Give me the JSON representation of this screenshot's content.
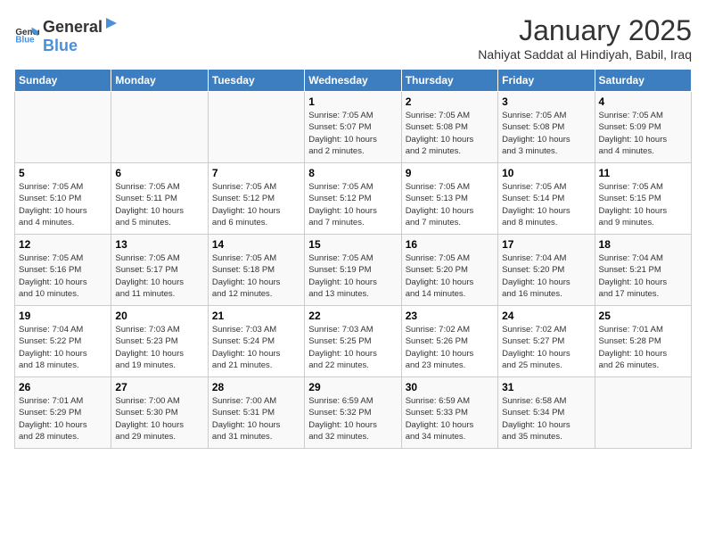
{
  "header": {
    "logo_general": "General",
    "logo_blue": "Blue",
    "title": "January 2025",
    "subtitle": "Nahiyat Saddat al Hindiyah, Babil, Iraq"
  },
  "days_of_week": [
    "Sunday",
    "Monday",
    "Tuesday",
    "Wednesday",
    "Thursday",
    "Friday",
    "Saturday"
  ],
  "weeks": [
    [
      {
        "day": "",
        "info": ""
      },
      {
        "day": "",
        "info": ""
      },
      {
        "day": "",
        "info": ""
      },
      {
        "day": "1",
        "info": "Sunrise: 7:05 AM\nSunset: 5:07 PM\nDaylight: 10 hours\nand 2 minutes."
      },
      {
        "day": "2",
        "info": "Sunrise: 7:05 AM\nSunset: 5:08 PM\nDaylight: 10 hours\nand 2 minutes."
      },
      {
        "day": "3",
        "info": "Sunrise: 7:05 AM\nSunset: 5:08 PM\nDaylight: 10 hours\nand 3 minutes."
      },
      {
        "day": "4",
        "info": "Sunrise: 7:05 AM\nSunset: 5:09 PM\nDaylight: 10 hours\nand 4 minutes."
      }
    ],
    [
      {
        "day": "5",
        "info": "Sunrise: 7:05 AM\nSunset: 5:10 PM\nDaylight: 10 hours\nand 4 minutes."
      },
      {
        "day": "6",
        "info": "Sunrise: 7:05 AM\nSunset: 5:11 PM\nDaylight: 10 hours\nand 5 minutes."
      },
      {
        "day": "7",
        "info": "Sunrise: 7:05 AM\nSunset: 5:12 PM\nDaylight: 10 hours\nand 6 minutes."
      },
      {
        "day": "8",
        "info": "Sunrise: 7:05 AM\nSunset: 5:12 PM\nDaylight: 10 hours\nand 7 minutes."
      },
      {
        "day": "9",
        "info": "Sunrise: 7:05 AM\nSunset: 5:13 PM\nDaylight: 10 hours\nand 7 minutes."
      },
      {
        "day": "10",
        "info": "Sunrise: 7:05 AM\nSunset: 5:14 PM\nDaylight: 10 hours\nand 8 minutes."
      },
      {
        "day": "11",
        "info": "Sunrise: 7:05 AM\nSunset: 5:15 PM\nDaylight: 10 hours\nand 9 minutes."
      }
    ],
    [
      {
        "day": "12",
        "info": "Sunrise: 7:05 AM\nSunset: 5:16 PM\nDaylight: 10 hours\nand 10 minutes."
      },
      {
        "day": "13",
        "info": "Sunrise: 7:05 AM\nSunset: 5:17 PM\nDaylight: 10 hours\nand 11 minutes."
      },
      {
        "day": "14",
        "info": "Sunrise: 7:05 AM\nSunset: 5:18 PM\nDaylight: 10 hours\nand 12 minutes."
      },
      {
        "day": "15",
        "info": "Sunrise: 7:05 AM\nSunset: 5:19 PM\nDaylight: 10 hours\nand 13 minutes."
      },
      {
        "day": "16",
        "info": "Sunrise: 7:05 AM\nSunset: 5:20 PM\nDaylight: 10 hours\nand 14 minutes."
      },
      {
        "day": "17",
        "info": "Sunrise: 7:04 AM\nSunset: 5:20 PM\nDaylight: 10 hours\nand 16 minutes."
      },
      {
        "day": "18",
        "info": "Sunrise: 7:04 AM\nSunset: 5:21 PM\nDaylight: 10 hours\nand 17 minutes."
      }
    ],
    [
      {
        "day": "19",
        "info": "Sunrise: 7:04 AM\nSunset: 5:22 PM\nDaylight: 10 hours\nand 18 minutes."
      },
      {
        "day": "20",
        "info": "Sunrise: 7:03 AM\nSunset: 5:23 PM\nDaylight: 10 hours\nand 19 minutes."
      },
      {
        "day": "21",
        "info": "Sunrise: 7:03 AM\nSunset: 5:24 PM\nDaylight: 10 hours\nand 21 minutes."
      },
      {
        "day": "22",
        "info": "Sunrise: 7:03 AM\nSunset: 5:25 PM\nDaylight: 10 hours\nand 22 minutes."
      },
      {
        "day": "23",
        "info": "Sunrise: 7:02 AM\nSunset: 5:26 PM\nDaylight: 10 hours\nand 23 minutes."
      },
      {
        "day": "24",
        "info": "Sunrise: 7:02 AM\nSunset: 5:27 PM\nDaylight: 10 hours\nand 25 minutes."
      },
      {
        "day": "25",
        "info": "Sunrise: 7:01 AM\nSunset: 5:28 PM\nDaylight: 10 hours\nand 26 minutes."
      }
    ],
    [
      {
        "day": "26",
        "info": "Sunrise: 7:01 AM\nSunset: 5:29 PM\nDaylight: 10 hours\nand 28 minutes."
      },
      {
        "day": "27",
        "info": "Sunrise: 7:00 AM\nSunset: 5:30 PM\nDaylight: 10 hours\nand 29 minutes."
      },
      {
        "day": "28",
        "info": "Sunrise: 7:00 AM\nSunset: 5:31 PM\nDaylight: 10 hours\nand 31 minutes."
      },
      {
        "day": "29",
        "info": "Sunrise: 6:59 AM\nSunset: 5:32 PM\nDaylight: 10 hours\nand 32 minutes."
      },
      {
        "day": "30",
        "info": "Sunrise: 6:59 AM\nSunset: 5:33 PM\nDaylight: 10 hours\nand 34 minutes."
      },
      {
        "day": "31",
        "info": "Sunrise: 6:58 AM\nSunset: 5:34 PM\nDaylight: 10 hours\nand 35 minutes."
      },
      {
        "day": "",
        "info": ""
      }
    ]
  ]
}
